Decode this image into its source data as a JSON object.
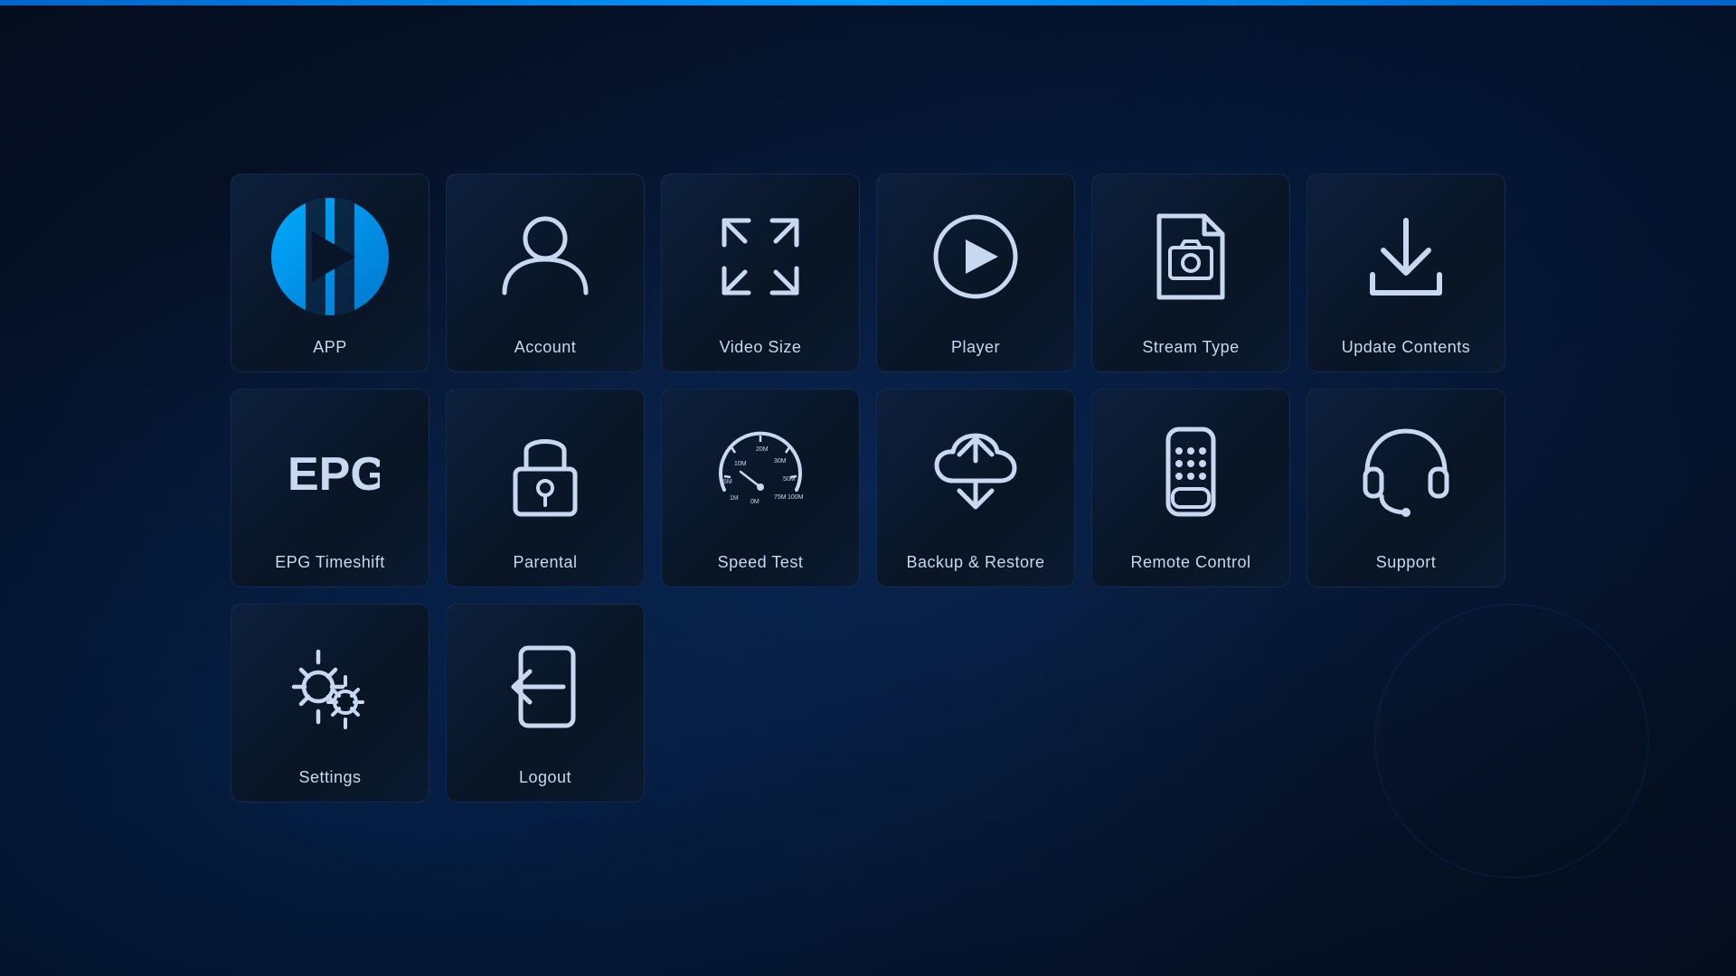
{
  "topBar": {
    "color": "#0088ff"
  },
  "tiles": [
    {
      "id": "app",
      "label": "APP",
      "icon": "app"
    },
    {
      "id": "account",
      "label": "Account",
      "icon": "account"
    },
    {
      "id": "video-size",
      "label": "Video Size",
      "icon": "video-size"
    },
    {
      "id": "player",
      "label": "Player",
      "icon": "player"
    },
    {
      "id": "stream-type",
      "label": "Stream Type",
      "icon": "stream-type"
    },
    {
      "id": "update-contents",
      "label": "Update Contents",
      "icon": "update-contents"
    },
    {
      "id": "epg-timeshift",
      "label": "EPG Timeshift",
      "icon": "epg"
    },
    {
      "id": "parental",
      "label": "Parental",
      "icon": "parental"
    },
    {
      "id": "speed-test",
      "label": "Speed Test",
      "icon": "speed-test"
    },
    {
      "id": "backup-restore",
      "label": "Backup & Restore",
      "icon": "backup-restore"
    },
    {
      "id": "remote-control",
      "label": "Remote Control",
      "icon": "remote-control"
    },
    {
      "id": "support",
      "label": "Support",
      "icon": "support"
    },
    {
      "id": "settings",
      "label": "Settings",
      "icon": "settings"
    },
    {
      "id": "logout",
      "label": "Logout",
      "icon": "logout"
    }
  ]
}
